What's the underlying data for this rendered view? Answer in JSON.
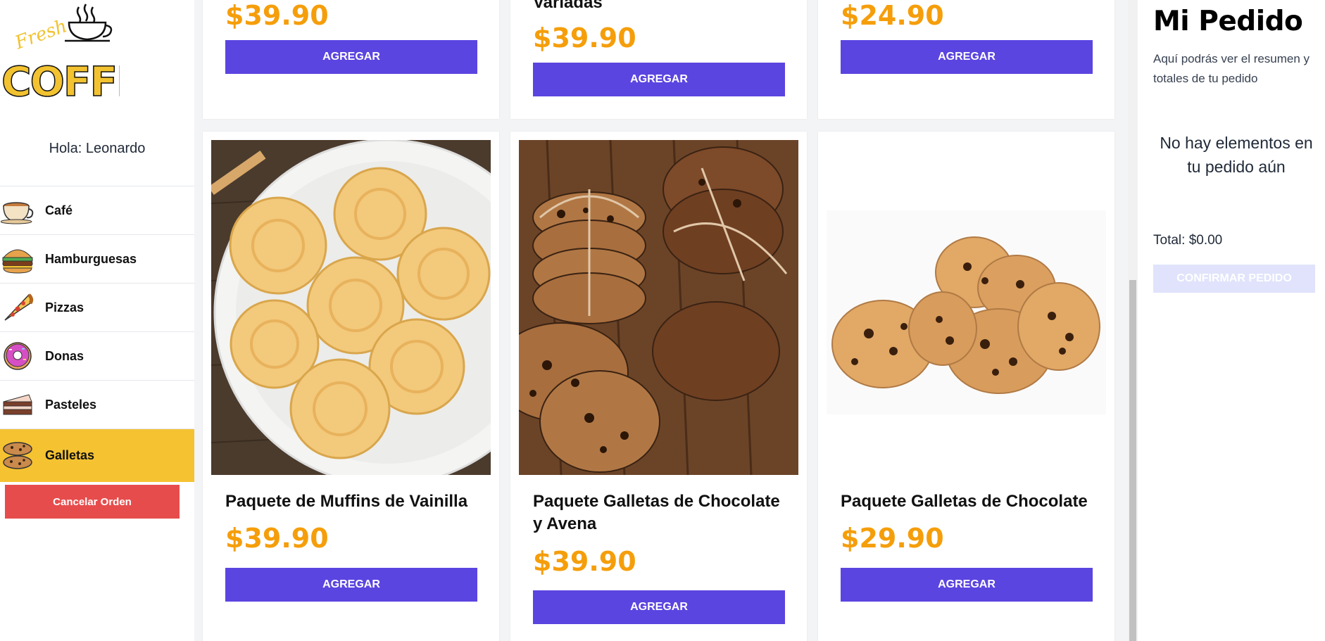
{
  "brand": {
    "logo_small_text": "Fresh",
    "logo_text": "COFFEE",
    "colors": {
      "logo_yellow": "#f2c230",
      "primary": "#5b45e0",
      "price": "#f59e0b",
      "active_category": "#f5c232",
      "cancel": "#e74c4c"
    }
  },
  "sidebar": {
    "greeting": "Hola: Leonardo",
    "categories": [
      {
        "label": "Café",
        "icon": "coffee-cup-icon",
        "active": false
      },
      {
        "label": "Hamburguesas",
        "icon": "burger-icon",
        "active": false
      },
      {
        "label": "Pizzas",
        "icon": "pizza-slice-icon",
        "active": false
      },
      {
        "label": "Donas",
        "icon": "donut-icon",
        "active": false
      },
      {
        "label": "Pasteles",
        "icon": "cake-slice-icon",
        "active": false
      },
      {
        "label": "Galletas",
        "icon": "cookies-icon",
        "active": true
      }
    ],
    "cancel_label": "Cancelar Orden"
  },
  "products": {
    "top_row": [
      {
        "name": "",
        "price": "$39.90",
        "button": "AGREGAR"
      },
      {
        "name": "Variadas",
        "price": "$39.90",
        "button": "AGREGAR"
      },
      {
        "name": "",
        "price": "$24.90",
        "button": "AGREGAR"
      }
    ],
    "bottom_row": [
      {
        "name": "Paquete de Muffins de Vainilla",
        "price": "$39.90",
        "button": "AGREGAR",
        "image": "vanilla-cookies-plate"
      },
      {
        "name": "Paquete Galletas de Chocolate y Avena",
        "price": "$39.90",
        "button": "AGREGAR",
        "image": "chocolate-oat-cookies"
      },
      {
        "name": "Paquete Galletas de Chocolate",
        "price": "$29.90",
        "button": "AGREGAR",
        "image": "chocolate-chip-cookies"
      }
    ]
  },
  "order": {
    "title": "Mi Pedido",
    "subtitle": "Aquí podrás ver el resumen y totales de tu pedido",
    "empty_message": "No hay elementos en tu pedido aún",
    "total": "Total: $0.00",
    "confirm_label": "CONFIRMAR PEDIDO"
  }
}
